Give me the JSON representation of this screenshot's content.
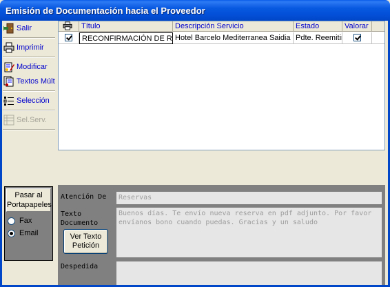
{
  "window": {
    "title": "Emisión de Documentación hacia el Proveedor"
  },
  "toolbar": {
    "items": [
      {
        "label": "Salir",
        "icon": "exit-door-icon",
        "enabled": true
      },
      {
        "label": "Imprimir",
        "icon": "printer-icon",
        "enabled": true
      },
      {
        "label": "Modificar",
        "icon": "edit-document-icon",
        "enabled": true
      },
      {
        "label": "Textos Múlt",
        "icon": "multi-text-icon",
        "enabled": true
      },
      {
        "label": "Selección",
        "icon": "selection-list-icon",
        "enabled": true
      },
      {
        "label": "Sel.Serv.",
        "icon": "service-list-icon",
        "enabled": false
      }
    ]
  },
  "grid": {
    "columns": {
      "print": "printer-icon",
      "titulo": "Título",
      "descripcion": "Descripción Servicio",
      "estado": "Estado",
      "valorar": "Valorar"
    },
    "rows": [
      {
        "print_checked": true,
        "titulo": "RECONFIRMACIÓN DE RESI",
        "descripcion": "Hotel Barcelo Mediterranea Saidia",
        "estado": "Pdte. Reemitir",
        "valorar_checked": true
      }
    ]
  },
  "options": {
    "title": "Pasar al Portapapeles",
    "radios": [
      {
        "label": "Fax",
        "selected": false
      },
      {
        "label": "Email",
        "selected": true
      }
    ]
  },
  "form": {
    "atencion_label": "Atención De",
    "atencion_value": "Reservas",
    "texto_label_1": "Texto",
    "texto_label_2": "Documento",
    "texto_value": "Buenos días. Te envío nueva reserva en pdf adjunto. Por favor envíanos bono cuando puedas. Gracias y un saludo",
    "ver_texto_button": "Ver Texto Petición",
    "despedida_label": "Despedida",
    "despedida_value": ""
  },
  "colors": {
    "titlebar": "#0450D8",
    "toolbar_link": "#0000CC",
    "panel_gray": "#808080",
    "window_bg": "#ECE9D8"
  }
}
